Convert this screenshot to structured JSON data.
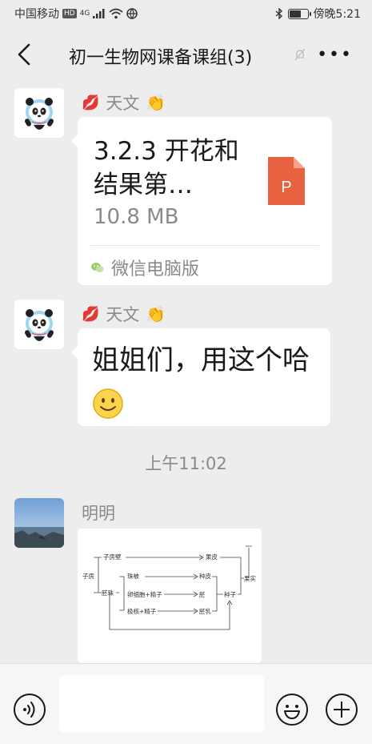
{
  "status_bar": {
    "carrier": "中国移动",
    "hd_badge": "HD",
    "signal_type": "4G",
    "time": "傍晚5:21",
    "battery_level": 0.7
  },
  "nav": {
    "title": "初一生物网课备课组(3)",
    "back_icon": "chevron-left-icon",
    "more_label": "•••"
  },
  "messages": [
    {
      "sender": "天文",
      "sender_prefix_emoji": "💋",
      "sender_suffix_emoji": "👏",
      "file": {
        "name": "3.2.3 开花和结果第…",
        "size": "10.8 MB",
        "source": "微信电脑版",
        "type_icon_letter": "P",
        "type_color": "#e8623f"
      }
    },
    {
      "sender": "天文",
      "sender_prefix_emoji": "💋",
      "sender_suffix_emoji": "👏",
      "text": "姐姐们，用这个哈"
    },
    {
      "time": "上午11:02"
    },
    {
      "sender": "明明",
      "image": {
        "labels": {
          "zifang": "子房",
          "zifangbi": "子房壁",
          "guopi": "果皮",
          "guoshi": "果实",
          "peizhu": "胚珠",
          "zhubei": "珠被",
          "zhongpi": "种皮",
          "luanxibao": "卵细胞+精子",
          "pei": "胚",
          "jihe": "极核+精子",
          "peiru": "胚乳",
          "zhongzi": "种子"
        }
      }
    }
  ]
}
